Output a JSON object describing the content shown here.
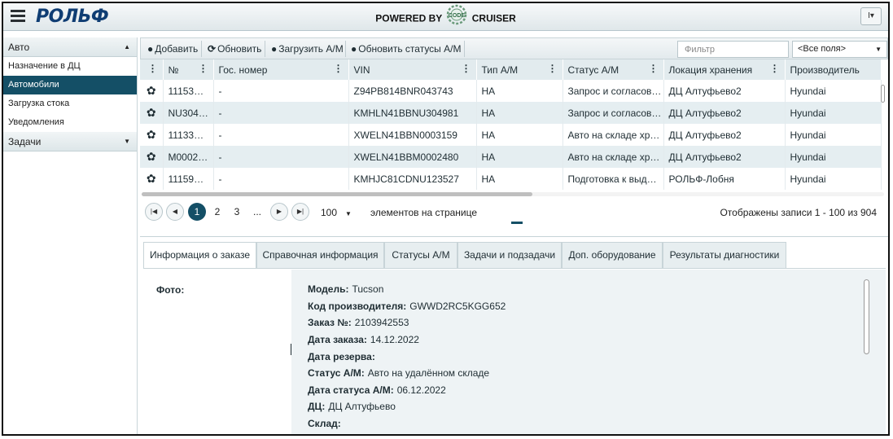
{
  "header": {
    "logo": "РОЛЬФ",
    "powered_by": "POWERED BY",
    "brand": "CRUISER",
    "brand_badge": "CODE",
    "user_menu": "I▾"
  },
  "sidebar": {
    "groups": [
      {
        "label": "Авто",
        "caret": "▲"
      },
      {
        "label": "Задачи",
        "caret": "▼"
      }
    ],
    "items": [
      {
        "label": "Назначение в ДЦ"
      },
      {
        "label": "Автомобили"
      },
      {
        "label": "Загрузка стока"
      },
      {
        "label": "Уведомления"
      }
    ]
  },
  "toolbar": {
    "add": "Добавить",
    "refresh": "Обновить",
    "upload": "Загрузить А/М",
    "refresh_status": "Обновить статусы А/М",
    "filter_placeholder": "Фильтр",
    "filter_field": "<Все поля>"
  },
  "grid": {
    "columns": [
      "№",
      "Гос. номер",
      "VIN",
      "Тип А/М",
      "Статус А/М",
      "Локация хранения",
      "Производитель"
    ],
    "rows": [
      [
        "11153…",
        "-",
        "Z94PB814BNR043743",
        "НА",
        "Запрос и согласов…",
        "ДЦ Алтуфьево2",
        "Hyundai"
      ],
      [
        "NU304…",
        "-",
        "KMHLN41BBNU304981",
        "НА",
        "Запрос и согласов…",
        "ДЦ Алтуфьево2",
        "Hyundai"
      ],
      [
        "11133…",
        "-",
        "XWELN41BBN0003159",
        "НА",
        "Авто на складе хр…",
        "ДЦ Алтуфьево2",
        "Hyundai"
      ],
      [
        "M0002…",
        "-",
        "XWELN41BBM0002480",
        "НА",
        "Авто на складе хр…",
        "ДЦ Алтуфьево2",
        "Hyundai"
      ],
      [
        "11159…",
        "-",
        "KMHJC81CDNU123527",
        "НА",
        "Подготовка к выд…",
        "РОЛЬФ-Лобня",
        "Hyundai"
      ]
    ]
  },
  "pager": {
    "pages": [
      "1",
      "2",
      "3",
      "..."
    ],
    "per_page": "100",
    "per_page_label": "элементов на странице",
    "records": "Отображены записи 1 - 100 из 904"
  },
  "detail": {
    "tabs": [
      "Информация о заказе",
      "Справочная информация",
      "Статусы А/М",
      "Задачи и подзадачи",
      "Доп. оборудование",
      "Результаты диагностики"
    ],
    "photo_label": "Фото:",
    "fields": [
      {
        "label": "Модель:",
        "value": "Tucson"
      },
      {
        "label": "Код производителя:",
        "value": "GWWD2RC5KGG652"
      },
      {
        "label": "Заказ №:",
        "value": "2103942553"
      },
      {
        "label": "Дата заказа:",
        "value": "14.12.2022"
      },
      {
        "label": "Дата резерва:",
        "value": ""
      },
      {
        "label": "Статус А/М:",
        "value": "Авто на удалённом складе"
      },
      {
        "label": "Дата статуса А/М:",
        "value": "06.12.2022"
      },
      {
        "label": "ДЦ:",
        "value": "ДЦ Алтуфьево"
      },
      {
        "label": "Склад:",
        "value": ""
      }
    ]
  },
  "colors": {
    "accent": "#144f66",
    "header_bg": "#e2ebee",
    "alt_row": "#e5eef1"
  }
}
